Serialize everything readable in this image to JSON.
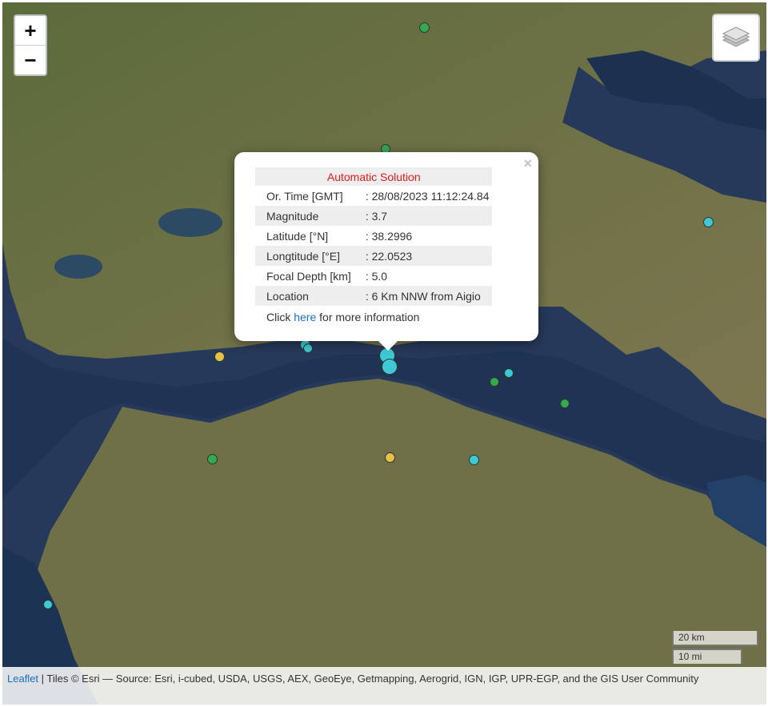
{
  "zoom": {
    "in_label": "+",
    "out_label": "−"
  },
  "icons": {
    "layers": "layers-icon"
  },
  "popup": {
    "title": "Automatic Solution",
    "close_label": "×",
    "rows": [
      {
        "label": "Or. Time [GMT]",
        "value": ": 28/08/2023 11:12:24.84"
      },
      {
        "label": "Magnitude",
        "value": ": 3.7"
      },
      {
        "label": "Latitude [°N]",
        "value": ": 38.2996"
      },
      {
        "label": "Longtitude [°E]",
        "value": ": 22.0523"
      },
      {
        "label": "Focal Depth [km]",
        "value": ": 5.0"
      },
      {
        "label": "Location",
        "value": ": 6 Km NNW from Aigio"
      }
    ],
    "more_prefix": "Click ",
    "more_link": "here",
    "more_suffix": " for more information"
  },
  "scale": {
    "km": "20 km",
    "mi": "10 mi"
  },
  "attribution": {
    "leaflet": "Leaflet",
    "text": " | Tiles © Esri — Source: Esri, i-cubed, USDA, USGS, AEX, GeoEye, Getmapping, Aerogrid, IGN, IGP, UPR-EGP, and the GIS User Community"
  },
  "colors": {
    "cyan": "#3fc9d6",
    "green": "#34a853",
    "yellow": "#e5c04a",
    "accent": "#e31b1b",
    "link": "#1a6fc4"
  }
}
